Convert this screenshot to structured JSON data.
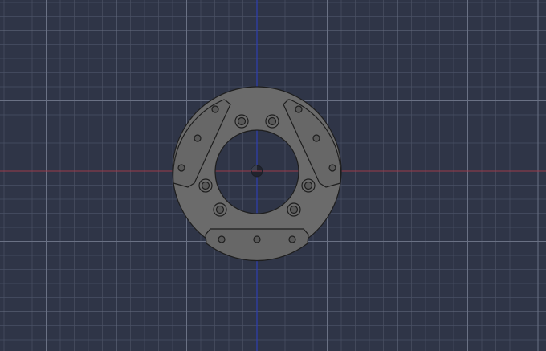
{
  "viewport": {
    "background": "#2f3547",
    "minor_grid_color": "#4a5164",
    "major_grid_color": "#6a7184",
    "x_axis_color": "#9b3a4a",
    "y_axis_color": "#2f3fb0"
  },
  "part": {
    "fill": "#6b6b6b",
    "edge": "#1e1e1e",
    "hole_fill": "#595959",
    "pads": [
      "left-pad",
      "right-pad",
      "bottom-pad"
    ],
    "hole_count": 14
  }
}
